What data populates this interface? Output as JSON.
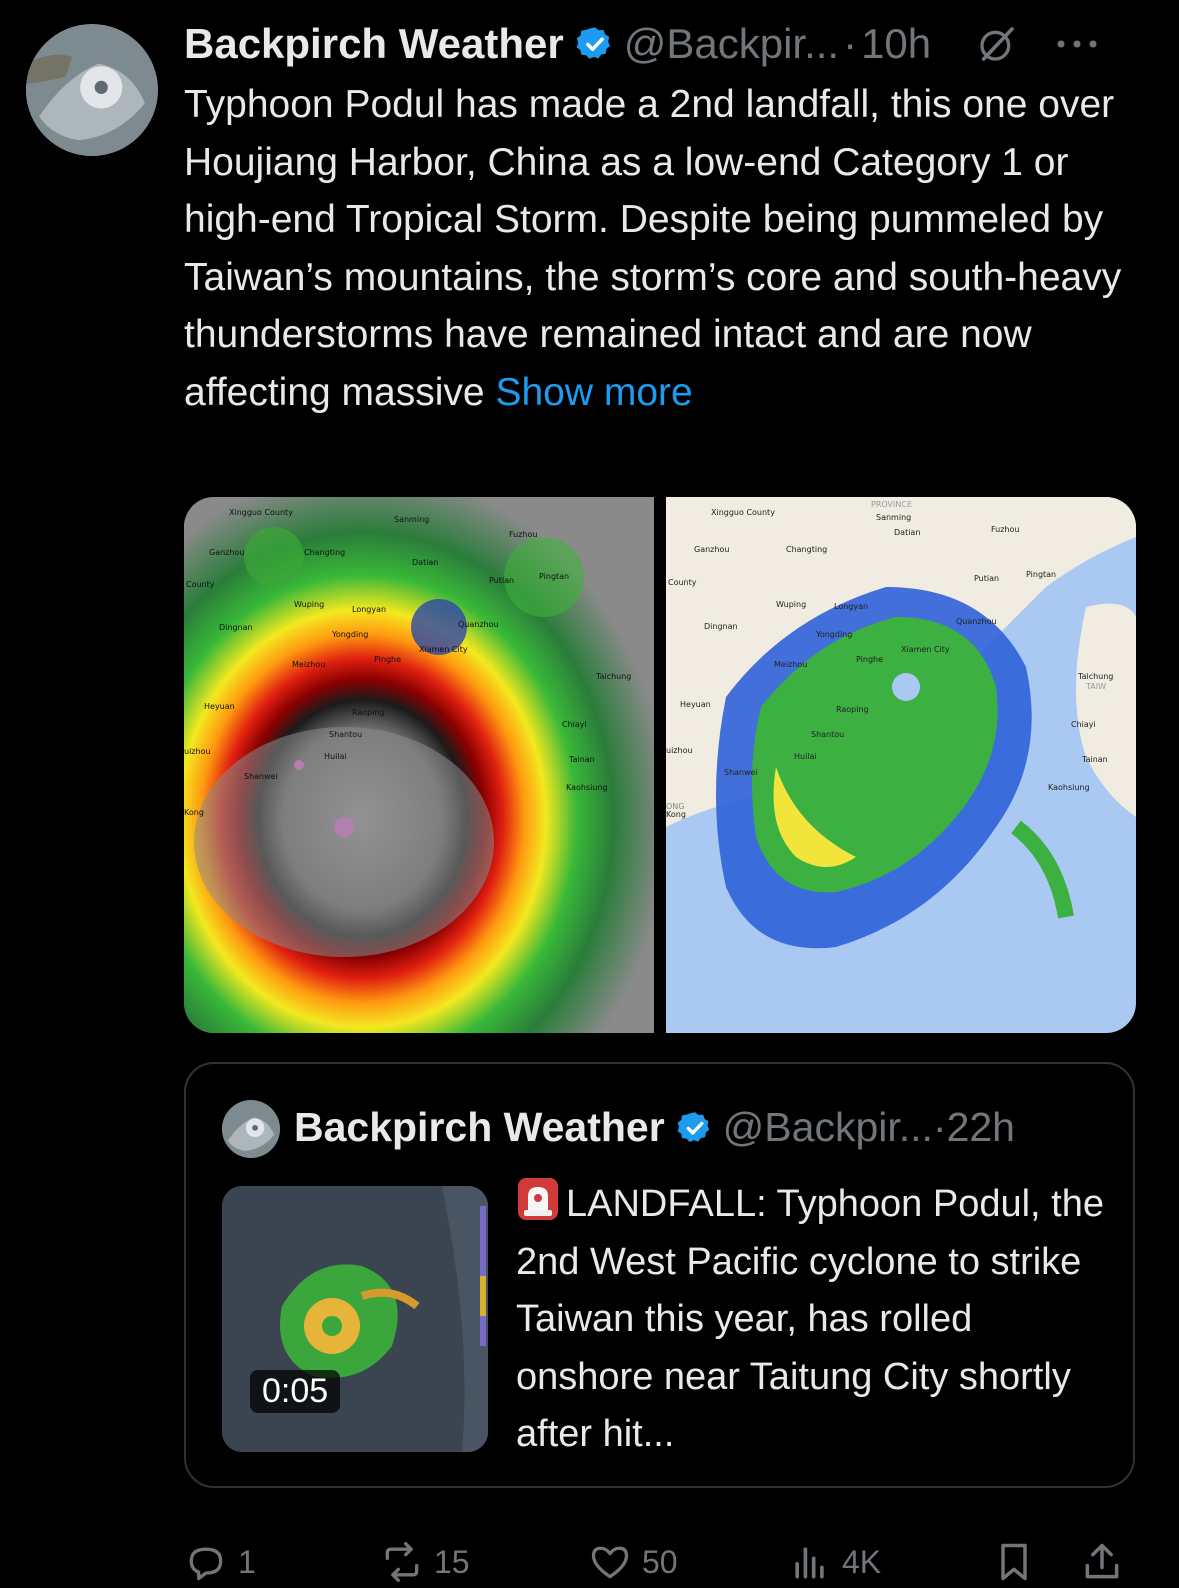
{
  "tweet": {
    "author": "Backpirch Weather",
    "handle": "@Backpir...",
    "separator": "·",
    "time": "10h",
    "text": "Typhoon Podul has made a 2nd landfall, this one over Houjiang Harbor, China as a low-end Category 1 or high-end Tropical Storm. Despite being pummeled by Taiwan’s mountains, the storm’s core and south-heavy thunderstorms have remained intact and are now affecting massive ",
    "show_more": "Show more"
  },
  "media": {
    "left_labels": [
      "Xingguo County",
      "Sanming",
      "Ganzhou",
      "Changting",
      "Fuzhou",
      "Datian",
      "Putian",
      "Pingtan",
      "County",
      "Wuping",
      "Longyan",
      "Quanzhou",
      "Dingnan",
      "Yongding",
      "Xiamen City",
      "Meizhou",
      "Pinghe",
      "Taichung",
      "Heyuan",
      "Raoping",
      "Chiayi",
      "Shantou",
      "Huilai",
      "Tainan",
      "uizhou",
      "Shanwei",
      "Kaohsiung",
      "Kong"
    ],
    "right_labels": [
      "Xingguo County",
      "PROVINCE",
      "Sanming",
      "Fuzhou",
      "Ganzhou",
      "Changting",
      "Datian",
      "Putian",
      "Pingtan",
      "County",
      "Wuping",
      "Longyan",
      "Quanzhou",
      "Dingnan",
      "Yongding",
      "Xiamen City",
      "Meizhou",
      "Pinghe",
      "Taichung",
      "TAIW",
      "Heyuan",
      "Raoping",
      "Chiayi",
      "Shantou",
      "Huilai",
      "uizhou",
      "Tainan",
      "Shanwei",
      "Kaohsiung",
      "ONG",
      "Kong"
    ]
  },
  "quote": {
    "author": "Backpirch Weather",
    "handle": "@Backpir...",
    "separator": "·",
    "time": "22h",
    "video_duration": "0:05",
    "text": "LANDFALL: Typhoon Podul, the 2nd West Pacific cyclone to strike Taiwan this year, has rolled onshore near Taitung City shortly after hit..."
  },
  "actions": {
    "replies": "1",
    "reposts": "15",
    "likes": "50",
    "views": "4K"
  },
  "colors": {
    "background": "#000000",
    "text": "#e7e9ea",
    "muted": "#71767b",
    "link": "#1d9bf0",
    "verified": "#1d9bf0"
  }
}
